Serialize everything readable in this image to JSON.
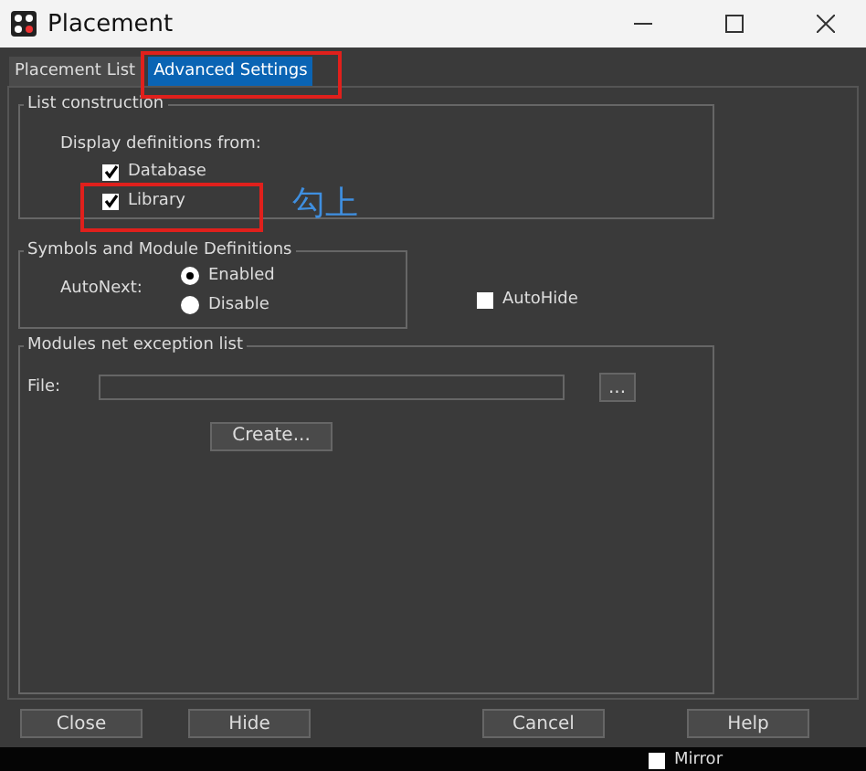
{
  "window": {
    "title": "Placement"
  },
  "tabs": [
    {
      "label": "Placement List",
      "selected": false
    },
    {
      "label": "Advanced Settings",
      "selected": true
    }
  ],
  "list_construction": {
    "title": "List construction",
    "label": "Display definitions from:",
    "options": [
      {
        "label": "Database",
        "checked": true
      },
      {
        "label": "Library",
        "checked": true
      }
    ]
  },
  "symbols": {
    "title": "Symbols and Module Definitions",
    "label": "AutoNext:",
    "options": [
      {
        "label": "Enabled",
        "selected": true
      },
      {
        "label": "Disable",
        "selected": false
      }
    ]
  },
  "autohide": {
    "label": "AutoHide",
    "checked": false
  },
  "modules": {
    "title": "Modules net exception list",
    "file_label": "File:",
    "browse": "...",
    "create": "Create..."
  },
  "buttons": [
    "Close",
    "Hide",
    "Cancel",
    "Help"
  ],
  "background": {
    "checkbox": {
      "label": "Mirror",
      "checked": false
    }
  },
  "annotation": {
    "text": "勾上"
  }
}
